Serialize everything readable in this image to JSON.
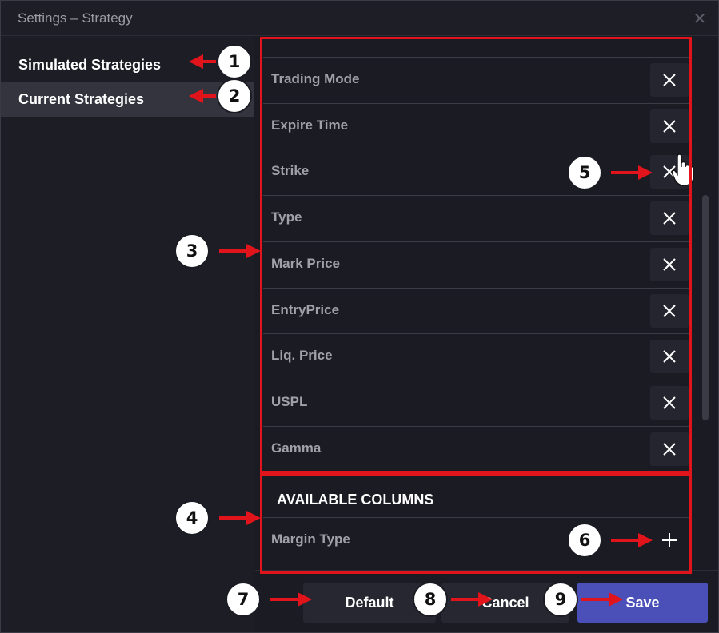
{
  "window": {
    "title": "Settings – Strategy"
  },
  "sidebar": {
    "items": [
      {
        "label": "Simulated Strategies",
        "selected": false
      },
      {
        "label": "Current Strategies",
        "selected": true
      }
    ]
  },
  "columns": {
    "selected": [
      {
        "label": "Trading Mode",
        "action_icon": "close-icon"
      },
      {
        "label": "Expire Time",
        "action_icon": "close-icon"
      },
      {
        "label": "Strike",
        "action_icon": "close-icon"
      },
      {
        "label": "Type",
        "action_icon": "close-icon"
      },
      {
        "label": "Mark Price",
        "action_icon": "close-icon"
      },
      {
        "label": "EntryPrice",
        "action_icon": "close-icon"
      },
      {
        "label": "Liq. Price",
        "action_icon": "close-icon"
      },
      {
        "label": "USPL",
        "action_icon": "close-icon"
      },
      {
        "label": "Gamma",
        "action_icon": "close-icon"
      }
    ],
    "available_heading": "AVAILABLE COLUMNS",
    "available": [
      {
        "label": "Margin Type",
        "action_icon": "plus-icon"
      }
    ]
  },
  "footer": {
    "default_label": "Default",
    "cancel_label": "Cancel",
    "save_label": "Save"
  },
  "annotations": {
    "markers": [
      "1",
      "2",
      "3",
      "4",
      "5",
      "6",
      "7",
      "8",
      "9"
    ],
    "color": "#e1141c"
  },
  "colors": {
    "accent": "#4b50b9",
    "background": "#1a1b23",
    "selected_item": "#33343e"
  }
}
